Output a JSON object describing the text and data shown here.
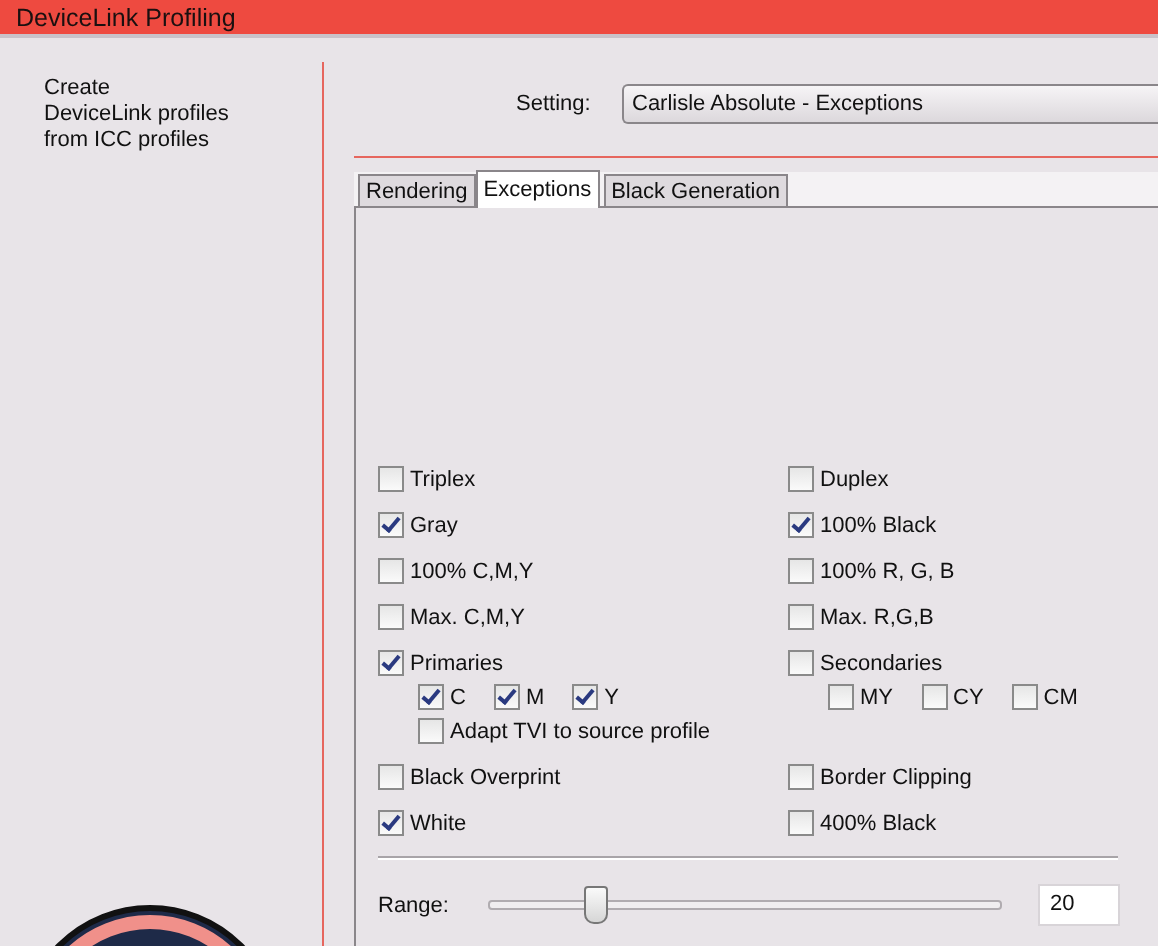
{
  "window": {
    "title": "DeviceLink Profiling"
  },
  "sidebar": {
    "description": "Create\nDeviceLink profiles\nfrom ICC profiles"
  },
  "setting": {
    "label": "Setting:",
    "value": "Carlisle Absolute - Exceptions"
  },
  "tabs": [
    {
      "label": "Rendering",
      "selected": false
    },
    {
      "label": "Exceptions",
      "selected": true
    },
    {
      "label": "Black Generation",
      "selected": false
    }
  ],
  "option_rows": [
    {
      "left": {
        "label": "Triplex",
        "checked": false
      },
      "right": {
        "label": "Duplex",
        "checked": false
      }
    },
    {
      "left": {
        "label": "Gray",
        "checked": true
      },
      "right": {
        "label": "100% Black",
        "checked": true
      }
    },
    {
      "left": {
        "label": "100% C,M,Y",
        "checked": false
      },
      "right": {
        "label": "100% R, G, B",
        "checked": false
      }
    },
    {
      "left": {
        "label": "Max. C,M,Y",
        "checked": false
      },
      "right": {
        "label": "Max. R,G,B",
        "checked": false
      }
    },
    {
      "left": {
        "label": "Primaries",
        "checked": true,
        "children": [
          {
            "label": "C",
            "checked": true
          },
          {
            "label": "M",
            "checked": true
          },
          {
            "label": "Y",
            "checked": true
          }
        ],
        "detail_option": {
          "label": "Adapt TVI to source profile",
          "checked": false
        }
      },
      "right": {
        "label": "Secondaries",
        "checked": false,
        "children": [
          {
            "label": "MY",
            "checked": false
          },
          {
            "label": "CY",
            "checked": false
          },
          {
            "label": "CM",
            "checked": false
          }
        ]
      }
    },
    {
      "left": {
        "label": "Black Overprint",
        "checked": false
      },
      "right": {
        "label": "Border Clipping",
        "checked": false
      }
    },
    {
      "left": {
        "label": "White",
        "checked": true
      },
      "right": {
        "label": "400% Black",
        "checked": false
      }
    }
  ],
  "range": {
    "label": "Range:",
    "level": 0.21,
    "value": "20"
  }
}
